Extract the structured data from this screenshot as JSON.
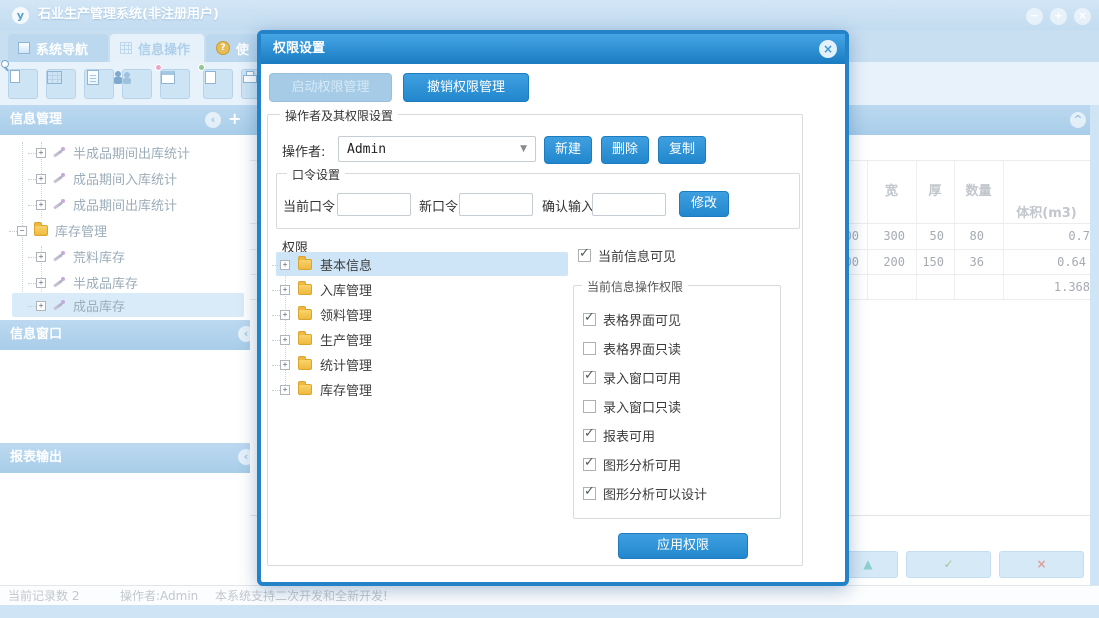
{
  "colors": {
    "accent": "#2a93d8",
    "dialog_border": "#2483c8",
    "panel_header": "#b0d2ec",
    "selection": "#cde5f7",
    "window_bg": "#cfe4f4",
    "confirm_green": "#98c9a0",
    "cancel_red": "#e09c9c",
    "navigate_teal": "#8ecfd0"
  },
  "window": {
    "logo_text": "y",
    "title": "石业生产管理系统(非注册用户)"
  },
  "icons": {
    "minimize": "−",
    "maximize": "+",
    "close": "×",
    "collapse_left": "‹",
    "collapse_up": "^",
    "add": "+",
    "expand": "+",
    "collapsed": "−",
    "help": "?",
    "dropdown": "▼",
    "check": "✓",
    "triangle_up": "▲",
    "cross": "×"
  },
  "tabs": [
    {
      "label": "系统导航",
      "icon": "checkbox-icon",
      "active": false
    },
    {
      "label": "信息操作",
      "icon": "grid-icon",
      "active": true
    },
    {
      "label": "使",
      "icon": "help-coin-icon",
      "active": false
    }
  ],
  "toolbar": {
    "buttons": [
      "search-preview",
      "data-table",
      "document",
      "operators",
      "form-window",
      "export",
      "print"
    ]
  },
  "sidebar": {
    "panels": [
      {
        "title": "信息管理"
      },
      {
        "title": "信息窗口"
      },
      {
        "title": "报表输出"
      }
    ],
    "tree": [
      {
        "label": "半成品期间出库统计",
        "level": 2,
        "icon": "wand",
        "selected": false
      },
      {
        "label": "成品期间入库统计",
        "level": 2,
        "icon": "wand",
        "selected": false
      },
      {
        "label": "成品期间出库统计",
        "level": 2,
        "icon": "wand",
        "selected": false
      },
      {
        "label": "库存管理",
        "level": 1,
        "icon": "folder",
        "expanded": true,
        "selected": false
      },
      {
        "label": "荒料库存",
        "level": 2,
        "icon": "wand",
        "selected": false
      },
      {
        "label": "半成品库存",
        "level": 2,
        "icon": "wand",
        "selected": false
      },
      {
        "label": "成品库存",
        "level": 2,
        "icon": "wand",
        "selected": true
      }
    ]
  },
  "dialog": {
    "title": "权限设置",
    "enable_btn": "启动权限管理",
    "revoke_btn": "撤销权限管理",
    "operator_group": {
      "title": "操作者及其权限设置",
      "operator_label": "操作者:",
      "operator_value": "Admin",
      "new_btn": "新建",
      "delete_btn": "删除",
      "copy_btn": "复制"
    },
    "password_group": {
      "title": "口令设置",
      "current_label": "当前口令",
      "new_label": "新口令",
      "confirm_label": "确认输入",
      "modify_btn": "修改"
    },
    "permissions": {
      "label": "权限",
      "tree": [
        {
          "label": "基本信息",
          "selected": true
        },
        {
          "label": "入库管理",
          "selected": false
        },
        {
          "label": "领料管理",
          "selected": false
        },
        {
          "label": "生产管理",
          "selected": false
        },
        {
          "label": "统计管理",
          "selected": false
        },
        {
          "label": "库存管理",
          "selected": false
        }
      ],
      "visible_cb": {
        "label": "当前信息可见",
        "checked": true
      },
      "op_group_title": "当前信息操作权限",
      "op_perms": [
        {
          "label": "表格界面可见",
          "checked": true
        },
        {
          "label": "表格界面只读",
          "checked": false
        },
        {
          "label": "录入窗口可用",
          "checked": true
        },
        {
          "label": "录入窗口只读",
          "checked": false
        },
        {
          "label": "报表可用",
          "checked": true
        },
        {
          "label": "图形分析可用",
          "checked": true
        },
        {
          "label": "图形分析可以设计",
          "checked": true
        }
      ],
      "apply_btn": "应用权限"
    }
  },
  "main_panel": {
    "table": {
      "columns": [
        "",
        "宽",
        "厚",
        "数量",
        "体积(m3)"
      ],
      "rows": [
        [
          "00",
          "300",
          "50",
          "80",
          "0.7"
        ],
        [
          "00",
          "200",
          "150",
          "36",
          "0.64"
        ],
        [
          "",
          "",
          "",
          "",
          "1.368"
        ]
      ]
    },
    "footer_buttons": [
      "navigate-up",
      "confirm",
      "cancel"
    ]
  },
  "status_bar": {
    "record_count": "当前记录数 2",
    "operator": "操作者:Admin",
    "message": "本系统支持二次开发和全新开发!"
  }
}
